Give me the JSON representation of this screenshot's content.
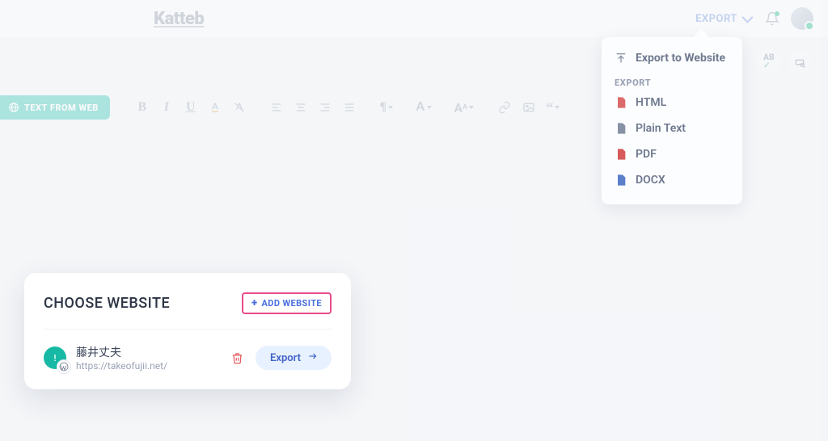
{
  "header": {
    "logo": "Katteb",
    "export_label": "EXPORT"
  },
  "export_dropdown": {
    "primary": "Export to Website",
    "section_label": "EXPORT",
    "items": [
      {
        "label": "HTML"
      },
      {
        "label": "Plain Text"
      },
      {
        "label": "PDF"
      },
      {
        "label": "DOCX"
      }
    ]
  },
  "toolbar": {
    "text_from_web": "TEXT FROM WEB",
    "font_letter": "A",
    "font_size_letter": "A"
  },
  "side_tools": {
    "ab_label": "AB"
  },
  "modal": {
    "title": "CHOOSE WEBSITE",
    "add_label": "ADD WEBSITE",
    "site": {
      "name": "藤井丈夫",
      "url": "https://takeofujii.net/"
    },
    "export_label": "Export"
  }
}
